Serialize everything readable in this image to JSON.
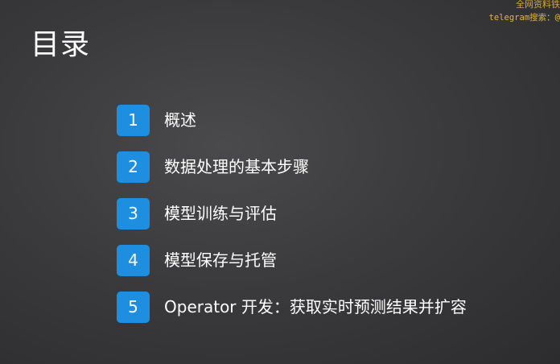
{
  "watermark": {
    "line1": "全网资料铁",
    "line2": "telegram搜索：@"
  },
  "title": "目录",
  "toc": [
    {
      "number": "1",
      "label": "概述"
    },
    {
      "number": "2",
      "label": "数据处理的基本步骤"
    },
    {
      "number": "3",
      "label": "模型训练与评估"
    },
    {
      "number": "4",
      "label": "模型保存与托管"
    },
    {
      "number": "5",
      "label": "Operator 开发：获取实时预测结果并扩容"
    }
  ],
  "colors": {
    "badge": "#1e8fe0",
    "watermark": "#d4a82a",
    "text": "#ffffff"
  }
}
